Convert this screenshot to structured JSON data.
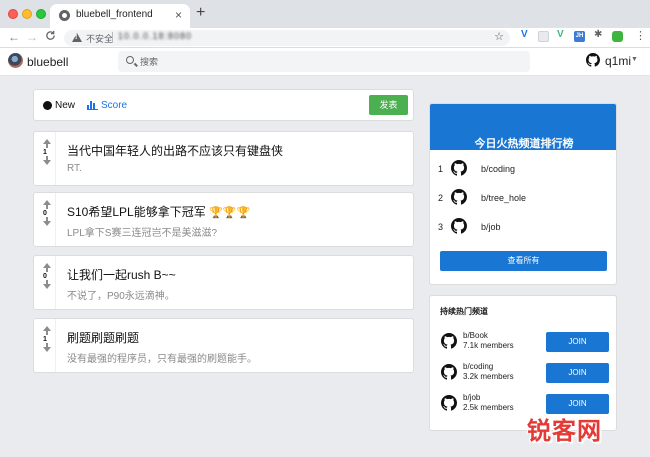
{
  "browser": {
    "tab_title": "bluebell_frontend",
    "tab_close": "×",
    "new_tab": "+",
    "security_label": "不安全",
    "url": "10.0.0.18:8080",
    "nav_back": "←",
    "nav_forward": "→",
    "nav_reload": "C",
    "star": "☆",
    "ext_jh": "JH"
  },
  "header": {
    "brand": "bluebell",
    "search_placeholder": "搜索",
    "username": "q1mi",
    "caret": "▼"
  },
  "sort_bar": {
    "new_label": "New",
    "score_label": "Score",
    "post_button": "发表"
  },
  "posts": [
    {
      "score": "1",
      "title": "当代中国年轻人的出路不应该只有键盘侠",
      "body": "RT."
    },
    {
      "score": "0",
      "title": "S10希望LPL能够拿下冠军",
      "trophies": "🏆🏆🏆",
      "body": "LPL拿下S赛三连冠岂不是美滋滋?"
    },
    {
      "score": "0",
      "title": "让我们一起rush B~~",
      "body": "不说了，P90永远滴神。"
    },
    {
      "score": "1",
      "title": "刷题刷题刷题",
      "body": "没有最强的程序员，只有最强的刷题能手。"
    }
  ],
  "ranking": {
    "title": "今日火热频道排行榜",
    "items": [
      {
        "rank": "1",
        "name": "b/coding"
      },
      {
        "rank": "2",
        "name": "b/tree_hole"
      },
      {
        "rank": "3",
        "name": "b/job"
      }
    ],
    "view_all": "查看所有"
  },
  "hot_channels": {
    "title": "持续热门频道",
    "items": [
      {
        "name": "b/Book",
        "members": "7.1k members",
        "join": "JOIN"
      },
      {
        "name": "b/coding",
        "members": "3.2k members",
        "join": "JOIN"
      },
      {
        "name": "b/job",
        "members": "2.5k members",
        "join": "JOIN"
      }
    ]
  },
  "watermark": "锐客网",
  "colors": {
    "accent_blue": "#1976d2",
    "post_green": "#4caf50",
    "watermark_red": "#e53935"
  }
}
